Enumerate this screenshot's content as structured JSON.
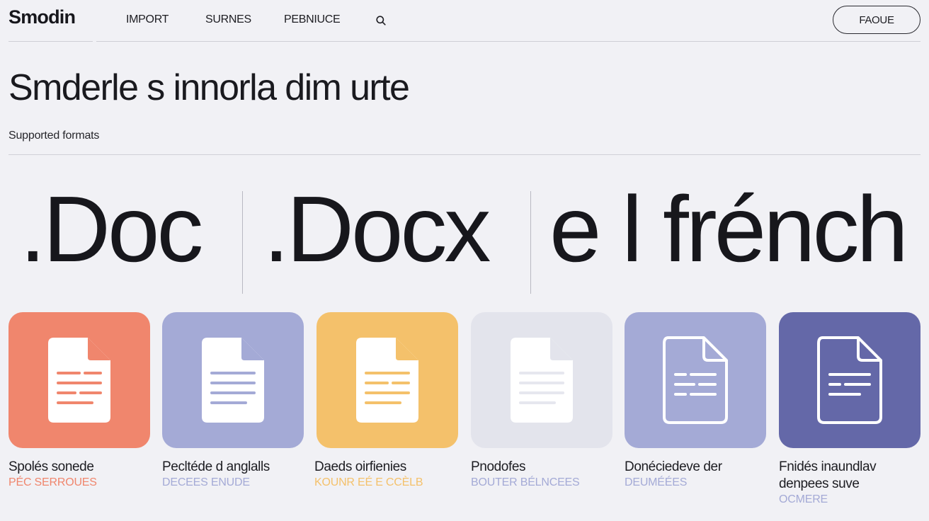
{
  "header": {
    "logo": "Smodin",
    "nav": [
      "IMPORT",
      "SURNES",
      "PEBNIUCE"
    ],
    "search_icon": "search-icon",
    "action_button": "FAOUE"
  },
  "hero": {
    "title": "Smderle s innorla dim urte",
    "section_label": "Supported formats"
  },
  "formats": [
    ".Doc",
    ".Docx",
    "e l frénch"
  ],
  "cards": [
    {
      "title": "Spolés sonede",
      "sub": "PÉC SERROUES",
      "bg": "#f0866d",
      "accent": "#f0866d",
      "sub_color": "#f0866d",
      "icon": "document-icon"
    },
    {
      "title": "Pecltéde d anglalls",
      "sub": "DECEES ENUDE",
      "bg": "#a4aad6",
      "accent": "#a4aad6",
      "sub_color": "#a4aad6",
      "icon": "document-icon"
    },
    {
      "title": "Daeds oirfienies",
      "sub": "KOUNR EÉ E CCÈLB",
      "bg": "#f4c16b",
      "accent": "#f4c16b",
      "sub_color": "#f4c16b",
      "icon": "document-icon"
    },
    {
      "title": "Pnodofes",
      "sub": "BOUTER BÉLNCEES",
      "bg": "#e3e4ec",
      "accent": "#e3e4ec",
      "sub_color": "#a4aad6",
      "icon": "document-icon"
    },
    {
      "title": "Donéciedeve der",
      "sub": "DEUMÉÉES",
      "bg": "#a4aad6",
      "accent": "#ffffff",
      "sub_color": "#a4aad6",
      "icon": "document-outline-icon"
    },
    {
      "title_lines": [
        "Fnidés inaundlav",
        "denpees suve"
      ],
      "sub": "OCMERE",
      "bg": "#6468a8",
      "accent": "#ffffff",
      "sub_color": "#a4aad6",
      "icon": "document-outline-icon"
    }
  ]
}
